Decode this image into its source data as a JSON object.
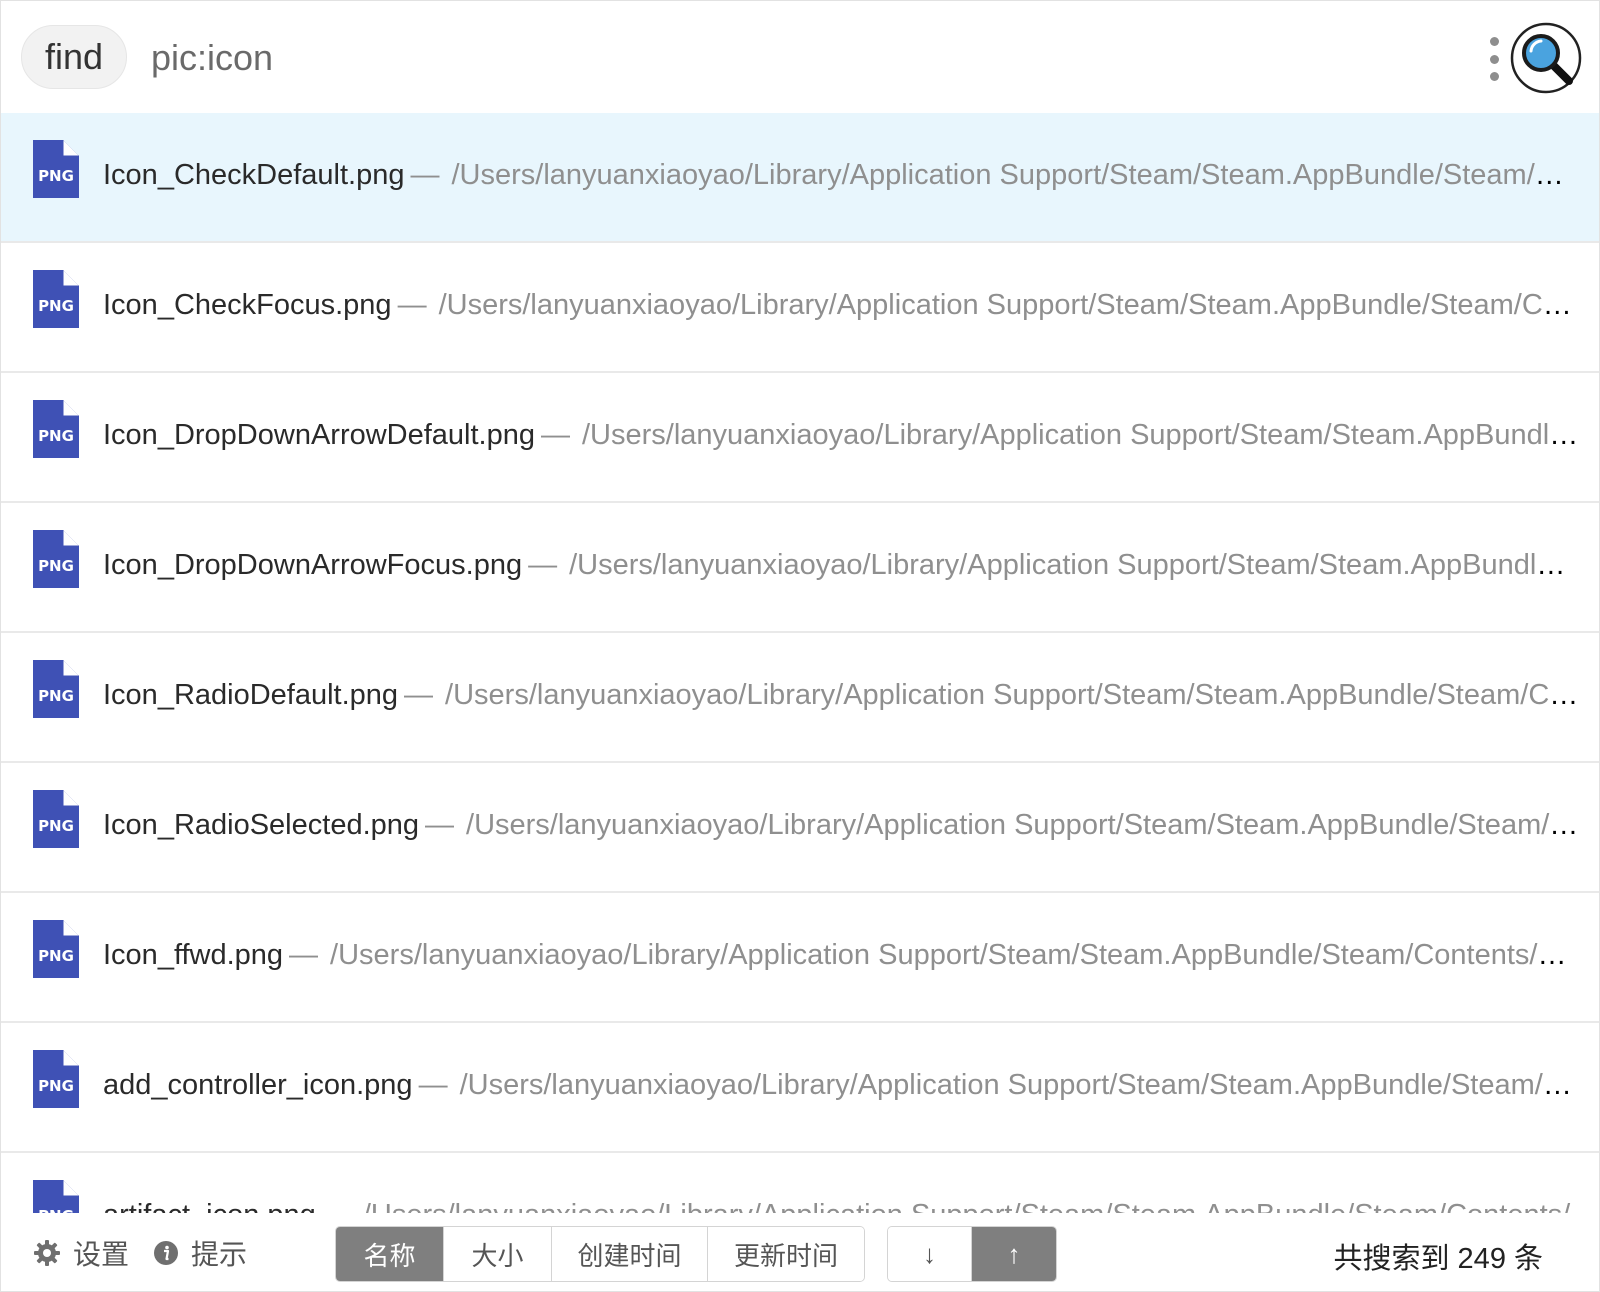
{
  "search": {
    "mode_label": "find",
    "query": "pic:icon"
  },
  "results": [
    {
      "name": "Icon_CheckDefault.png",
      "sep": "—",
      "path": "/Users/lanyuanxiaoyao/Library/Application Support/Steam/Steam.AppBundle/Steam/Con...",
      "badge": "PNG",
      "selected": true
    },
    {
      "name": "Icon_CheckFocus.png",
      "sep": "—",
      "path": "/Users/lanyuanxiaoyao/Library/Application Support/Steam/Steam.AppBundle/Steam/Cont...",
      "badge": "PNG",
      "selected": false
    },
    {
      "name": "Icon_DropDownArrowDefault.png",
      "sep": "—",
      "path": "/Users/lanyuanxiaoyao/Library/Application Support/Steam/Steam.AppBundle/...",
      "badge": "PNG",
      "selected": false
    },
    {
      "name": "Icon_DropDownArrowFocus.png",
      "sep": "—",
      "path": "/Users/lanyuanxiaoyao/Library/Application Support/Steam/Steam.AppBundle/St...",
      "badge": "PNG",
      "selected": false
    },
    {
      "name": "Icon_RadioDefault.png",
      "sep": "—",
      "path": "/Users/lanyuanxiaoyao/Library/Application Support/Steam/Steam.AppBundle/Steam/Con...",
      "badge": "PNG",
      "selected": false
    },
    {
      "name": "Icon_RadioSelected.png",
      "sep": "—",
      "path": "/Users/lanyuanxiaoyao/Library/Application Support/Steam/Steam.AppBundle/Steam/Co...",
      "badge": "PNG",
      "selected": false
    },
    {
      "name": "Icon_ffwd.png",
      "sep": "—",
      "path": "/Users/lanyuanxiaoyao/Library/Application Support/Steam/Steam.AppBundle/Steam/Contents/Ma...",
      "badge": "PNG",
      "selected": false
    },
    {
      "name": "add_controller_icon.png",
      "sep": "—",
      "path": "/Users/lanyuanxiaoyao/Library/Application Support/Steam/Steam.AppBundle/Steam/Co...",
      "badge": "PNG",
      "selected": false
    },
    {
      "name": "artifact_icon.png",
      "sep": "—",
      "path": "/Users/lanyuanxiaoyao/Library/Application Support/Steam/Steam.AppBundle/Steam/Contents/",
      "badge": "PNG",
      "selected": false
    }
  ],
  "footer": {
    "settings_label": "设置",
    "hint_label": "提示",
    "sort_options": [
      {
        "label": "名称",
        "active": true
      },
      {
        "label": "大小",
        "active": false
      },
      {
        "label": "创建时间",
        "active": false
      },
      {
        "label": "更新时间",
        "active": false
      }
    ],
    "order_options": [
      {
        "label": "↓",
        "active": false
      },
      {
        "label": "↑",
        "active": true
      }
    ],
    "count_text": "共搜索到 249 条"
  },
  "colors": {
    "selected_row": "#e8f6fd",
    "png_icon": "#3f51b5",
    "search_icon_lens": "#4aa3df",
    "active_segment": "#7f7f7f"
  },
  "icons": {
    "more": "vertical-dots",
    "search": "magnifier",
    "file": "png-document",
    "settings": "gear",
    "hint": "info-circle"
  }
}
